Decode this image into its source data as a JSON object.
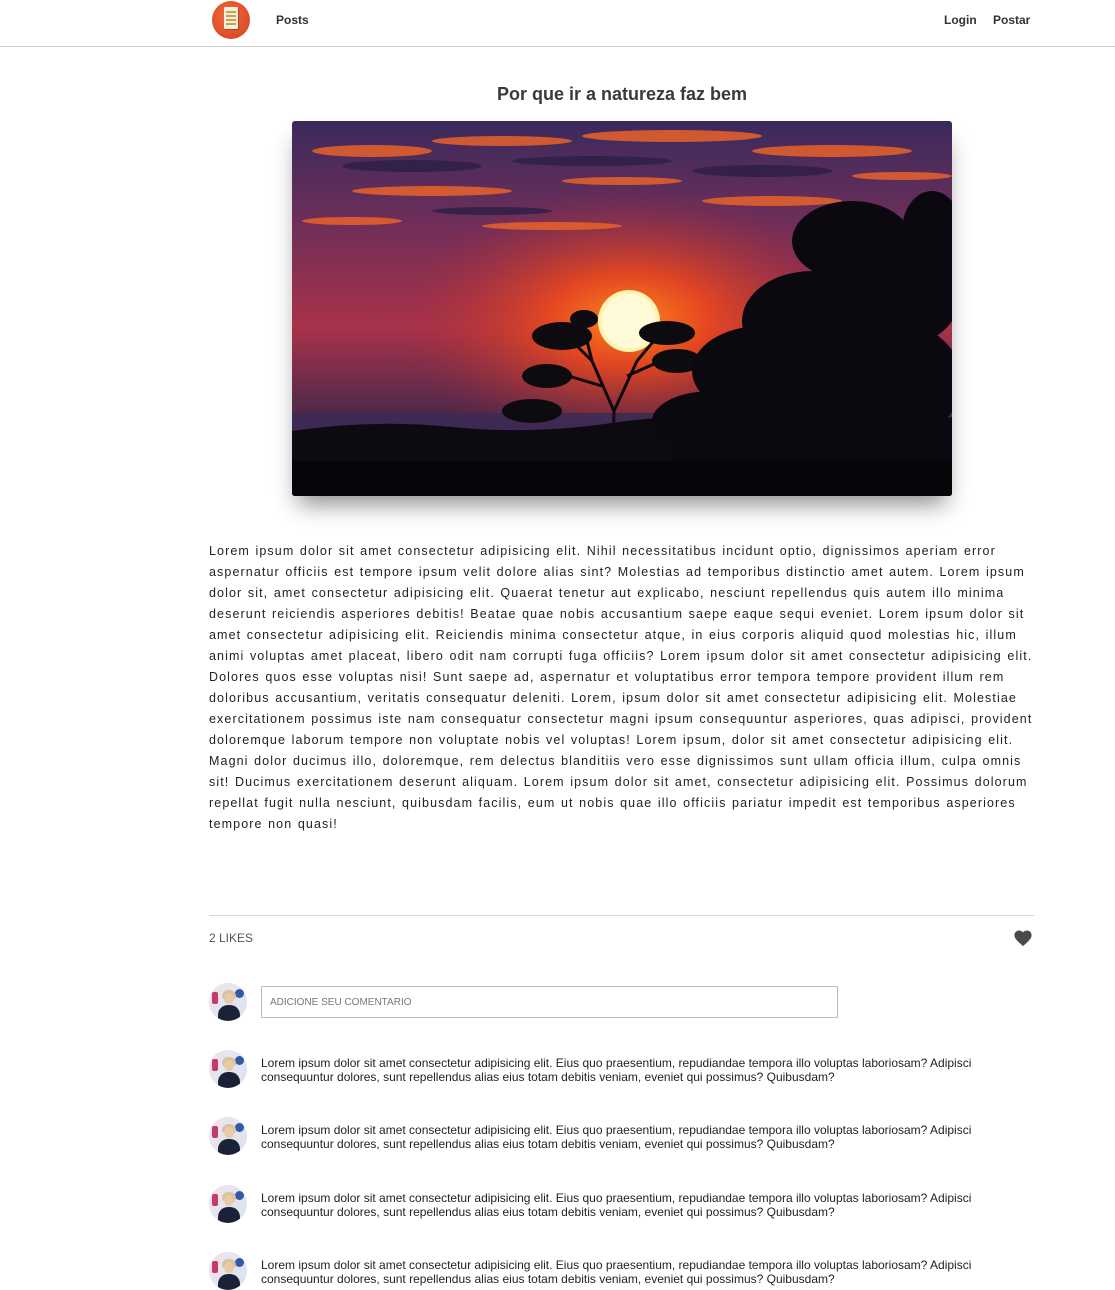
{
  "navbar": {
    "logo_icon": "newspaper-logo-icon",
    "posts_label": "Posts",
    "login_label": "Login",
    "postar_label": "Postar"
  },
  "post": {
    "title": "Por que ir a natureza faz bem",
    "image_icon": "sunset-landscape-photo",
    "body": "Lorem ipsum dolor sit amet consectetur adipisicing elit. Nihil necessitatibus incidunt optio, dignissimos aperiam error aspernatur officiis est tempore ipsum velit dolore alias sint? Molestias ad temporibus distinctio amet autem. Lorem ipsum dolor sit, amet consectetur adipisicing elit. Quaerat tenetur aut explicabo, nesciunt repellendus quis autem illo minima deserunt reiciendis asperiores debitis! Beatae quae nobis accusantium saepe eaque sequi eveniet. Lorem ipsum dolor sit amet consectetur adipisicing elit. Reiciendis minima consectetur atque, in eius corporis aliquid quod molestias hic, illum animi voluptas amet placeat, libero odit nam corrupti fuga officiis? Lorem ipsum dolor sit amet consectetur adipisicing elit. Dolores quos esse voluptas nisi! Sunt saepe ad, aspernatur et voluptatibus error tempora tempore provident illum rem doloribus accusantium, veritatis consequatur deleniti. Lorem, ipsum dolor sit amet consectetur adipisicing elit. Molestiae exercitationem possimus iste nam consequatur consectetur magni ipsum consequuntur asperiores, quas adipisci, provident doloremque laborum tempore non voluptate nobis vel voluptas! Lorem ipsum, dolor sit amet consectetur adipisicing elit. Magni dolor ducimus illo, doloremque, rem delectus blanditiis vero esse dignissimos sunt ullam officia illum, culpa omnis sit! Ducimus exercitationem deserunt aliquam. Lorem ipsum dolor sit amet, consectetur adipisicing elit. Possimus dolorum repellat fugit nulla nesciunt, quibusdam facilis, eum ut nobis quae illo officiis pariatur impedit est temporibus asperiores tempore non quasi!",
    "likes_label": "2 LIKES",
    "like_icon": "heart-icon"
  },
  "comment_form": {
    "placeholder": "ADICIONE SEU COMENTARIO",
    "avatar_icon": "user-avatar"
  },
  "comments": [
    {
      "text": "Lorem ipsum dolor sit amet consectetur adipisicing elit. Eius quo praesentium, repudiandae tempora illo voluptas laboriosam? Adipisci consequuntur dolores, sunt repellendus alias eius totam debitis veniam, eveniet qui possimus? Quibusdam?"
    },
    {
      "text": "Lorem ipsum dolor sit amet consectetur adipisicing elit. Eius quo praesentium, repudiandae tempora illo voluptas laboriosam? Adipisci consequuntur dolores, sunt repellendus alias eius totam debitis veniam, eveniet qui possimus? Quibusdam?"
    },
    {
      "text": "Lorem ipsum dolor sit amet consectetur adipisicing elit. Eius quo praesentium, repudiandae tempora illo voluptas laboriosam? Adipisci consequuntur dolores, sunt repellendus alias eius totam debitis veniam, eveniet qui possimus? Quibusdam?"
    },
    {
      "text": "Lorem ipsum dolor sit amet consectetur adipisicing elit. Eius quo praesentium, repudiandae tempora illo voluptas laboriosam? Adipisci consequuntur dolores, sunt repellendus alias eius totam debitis veniam, eveniet qui possimus? Quibusdam?"
    }
  ]
}
